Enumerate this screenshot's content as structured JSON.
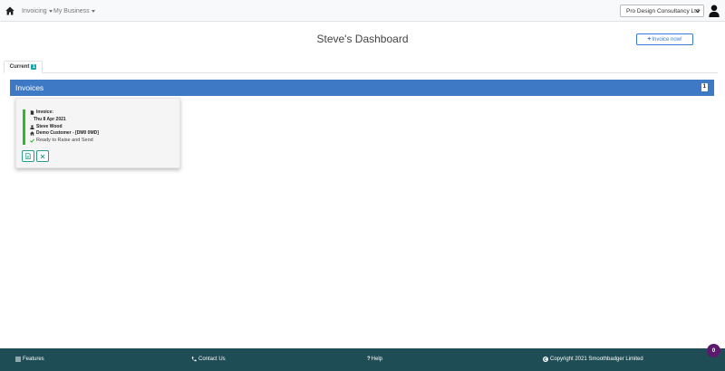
{
  "navbar": {
    "menus": [
      {
        "label": "Invoicing"
      },
      {
        "label": "My Business"
      }
    ],
    "company_select": "Pro Design Consultancy Ltd"
  },
  "header": {
    "title": "Steve's Dashboard",
    "new_invoice_label": "Invoice now!"
  },
  "tabs": [
    {
      "label": "Current",
      "count": "1"
    }
  ],
  "panel": {
    "title": "Invoices",
    "count": "1"
  },
  "invoice_card": {
    "type_label": "Invoice:",
    "date": "Thu 8 Apr 2021",
    "person": "Steve Wood",
    "customer": "Demo Customer - [DM0 0MD]",
    "status": "Ready to Raise and Send",
    "status_color": "#2eb82e"
  },
  "footer": {
    "features": "Features",
    "contact": "Contact Us",
    "help": "Help",
    "copyright": "Copyright 2021 Smoothbadger Limited"
  },
  "notification_count": "0",
  "colors": {
    "panel_header": "#3d79c4",
    "footer": "#1f4d55",
    "accent": "#3a7bd5"
  }
}
